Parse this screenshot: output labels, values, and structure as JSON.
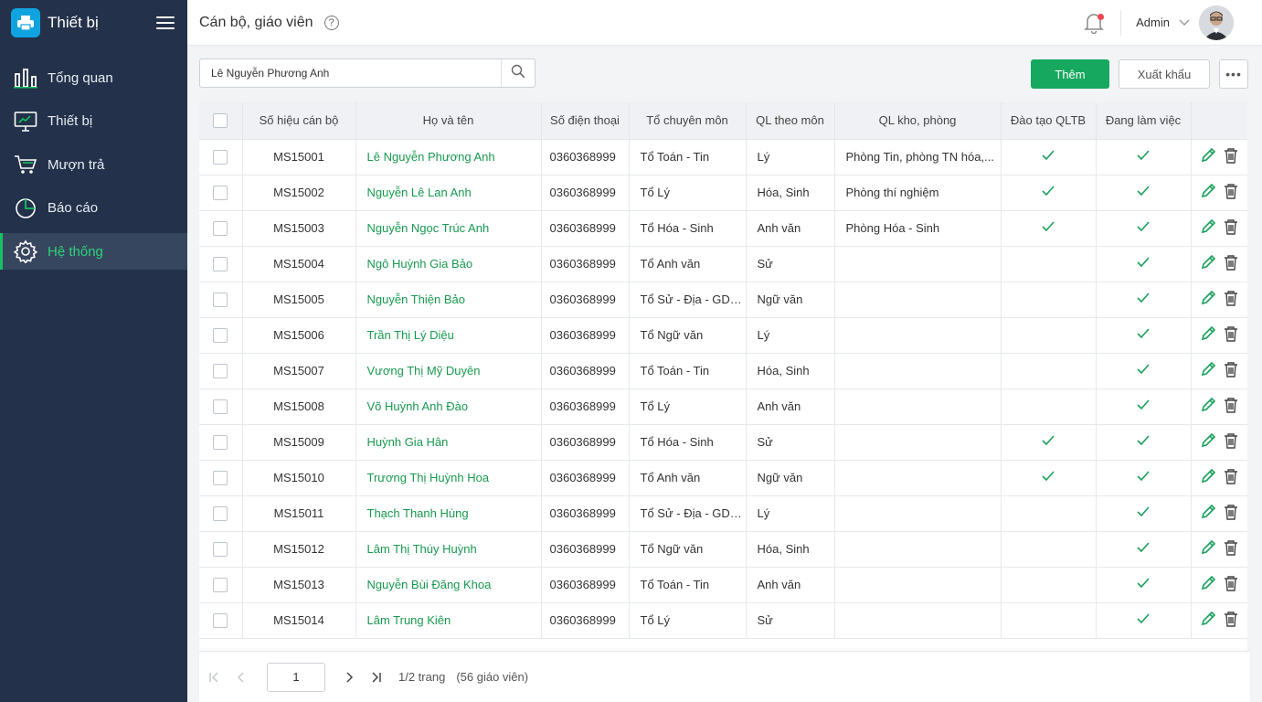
{
  "app": {
    "title": "Thiết bị"
  },
  "sidebar": {
    "items": [
      {
        "label": "Tổng quan",
        "icon": "chart-bars-icon"
      },
      {
        "label": "Thiết bị",
        "icon": "monitor-icon"
      },
      {
        "label": "Mượn trả",
        "icon": "cart-icon"
      },
      {
        "label": "Báo cáo",
        "icon": "pie-chart-icon"
      },
      {
        "label": "Hệ thống",
        "icon": "gear-icon",
        "active": true
      }
    ]
  },
  "header": {
    "title": "Cán bộ, giáo viên",
    "help": "?",
    "user": "Admin"
  },
  "toolbar": {
    "search_value": "Lê Nguyễn Phương Anh",
    "add_label": "Thêm",
    "export_label": "Xuất khẩu",
    "more_label": "•••"
  },
  "table": {
    "columns": [
      "Số hiệu cán bộ",
      "Họ và  tên",
      "Số điện thoại",
      "Tổ chuyên môn",
      "QL theo môn",
      "QL kho, phòng",
      "Đào tạo QLTB",
      "Đang làm việc"
    ],
    "rows": [
      {
        "id": "MS15001",
        "name": "Lê Nguyễn Phương Anh",
        "phone": "0360368999",
        "group": "Tổ Toán - Tin",
        "subject": "Lý",
        "room": "Phòng Tin, phòng TN hóa,...",
        "trained": true,
        "working": true
      },
      {
        "id": "MS15002",
        "name": "Nguyễn Lê  Lan Anh",
        "phone": "0360368999",
        "group": "Tổ Lý",
        "subject": "Hóa, Sinh",
        "room": "Phòng thí nghiệm",
        "trained": true,
        "working": true
      },
      {
        "id": "MS15003",
        "name": "Nguyễn Ngọc Trúc Anh",
        "phone": "0360368999",
        "group": "Tổ Hóa - Sinh",
        "subject": "Anh văn",
        "room": "Phòng Hóa - Sinh",
        "trained": true,
        "working": true
      },
      {
        "id": "MS15004",
        "name": "Ngô Huỳnh Gia Bảo",
        "phone": "0360368999",
        "group": "Tổ Anh văn",
        "subject": "Sử",
        "room": "",
        "trained": false,
        "working": true
      },
      {
        "id": "MS15005",
        "name": "Nguyễn Thiện Bảo",
        "phone": "0360368999",
        "group": "Tổ Sử - Địa - GDCD",
        "subject": "Ngữ văn",
        "room": "",
        "trained": false,
        "working": true
      },
      {
        "id": "MS15006",
        "name": "Trần Thị Lý Diệu",
        "phone": "0360368999",
        "group": "Tổ Ngữ văn",
        "subject": "Lý",
        "room": "",
        "trained": false,
        "working": true
      },
      {
        "id": "MS15007",
        "name": "Vương Thị Mỹ Duyên",
        "phone": "0360368999",
        "group": "Tổ Toán - Tin",
        "subject": "Hóa, Sinh",
        "room": "",
        "trained": false,
        "working": true
      },
      {
        "id": "MS15008",
        "name": "Võ Huỳnh Anh Đào",
        "phone": "0360368999",
        "group": "Tổ Lý",
        "subject": "Anh văn",
        "room": "",
        "trained": false,
        "working": true
      },
      {
        "id": "MS15009",
        "name": "Huỳnh Gia Hân",
        "phone": "0360368999",
        "group": "Tổ Hóa - Sinh",
        "subject": "Sử",
        "room": "",
        "trained": true,
        "working": true
      },
      {
        "id": "MS15010",
        "name": "Trương Thị Huỳnh Hoa",
        "phone": "0360368999",
        "group": "Tổ Anh văn",
        "subject": "Ngữ văn",
        "room": "",
        "trained": true,
        "working": true
      },
      {
        "id": "MS15011",
        "name": "Thạch Thanh Hùng",
        "phone": "0360368999",
        "group": "Tổ Sử - Địa - GDCD",
        "subject": "Lý",
        "room": "",
        "trained": false,
        "working": true
      },
      {
        "id": "MS15012",
        "name": "Lâm Thị Thúy Huỳnh",
        "phone": "0360368999",
        "group": "Tổ Ngữ văn",
        "subject": "Hóa, Sinh",
        "room": "",
        "trained": false,
        "working": true
      },
      {
        "id": "MS15013",
        "name": "Nguyễn Bùi Đăng Khoa",
        "phone": "0360368999",
        "group": "Tổ Toán - Tin",
        "subject": "Anh văn",
        "room": "",
        "trained": false,
        "working": true
      },
      {
        "id": "MS15014",
        "name": "Lâm Trung Kiên",
        "phone": "0360368999",
        "group": "Tổ Lý",
        "subject": "Sử",
        "room": "",
        "trained": false,
        "working": true
      }
    ]
  },
  "pagination": {
    "current": "1",
    "summary": "1/2 trang",
    "total": "(56 giáo viên)"
  },
  "colors": {
    "sidebar": "#23314a",
    "accent": "#16a85f",
    "active_text": "#2ed27a",
    "name_link": "#18994f"
  }
}
